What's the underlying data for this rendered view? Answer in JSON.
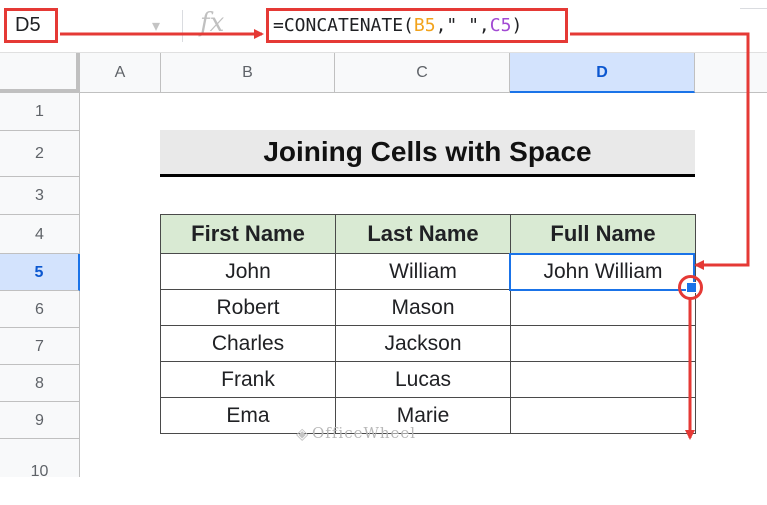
{
  "formula_bar": {
    "name_box": "D5",
    "fx_label": "fx",
    "formula_prefix": "=CONCATENATE(",
    "formula_ref1": "B5",
    "formula_mid": ",\" \",",
    "formula_ref2": "C5",
    "formula_suffix": ")"
  },
  "columns": [
    "A",
    "B",
    "C",
    "D"
  ],
  "rows": [
    "1",
    "2",
    "3",
    "4",
    "5",
    "6",
    "7",
    "8",
    "9",
    "10"
  ],
  "title": "Joining Cells with Space",
  "table": {
    "headers": [
      "First Name",
      "Last Name",
      "Full Name"
    ],
    "rows": [
      [
        "John",
        "William",
        "John William"
      ],
      [
        "Robert",
        "Mason",
        ""
      ],
      [
        "Charles",
        "Jackson",
        ""
      ],
      [
        "Frank",
        "Lucas",
        ""
      ],
      [
        "Ema",
        "Marie",
        ""
      ]
    ]
  },
  "watermark": "OfficeWheel",
  "colors": {
    "annotation_red": "#e53935",
    "selection_blue": "#1a73e8",
    "header_green": "#d9ead3",
    "ref_b": "#f2a31c",
    "ref_c": "#a24ad3"
  }
}
